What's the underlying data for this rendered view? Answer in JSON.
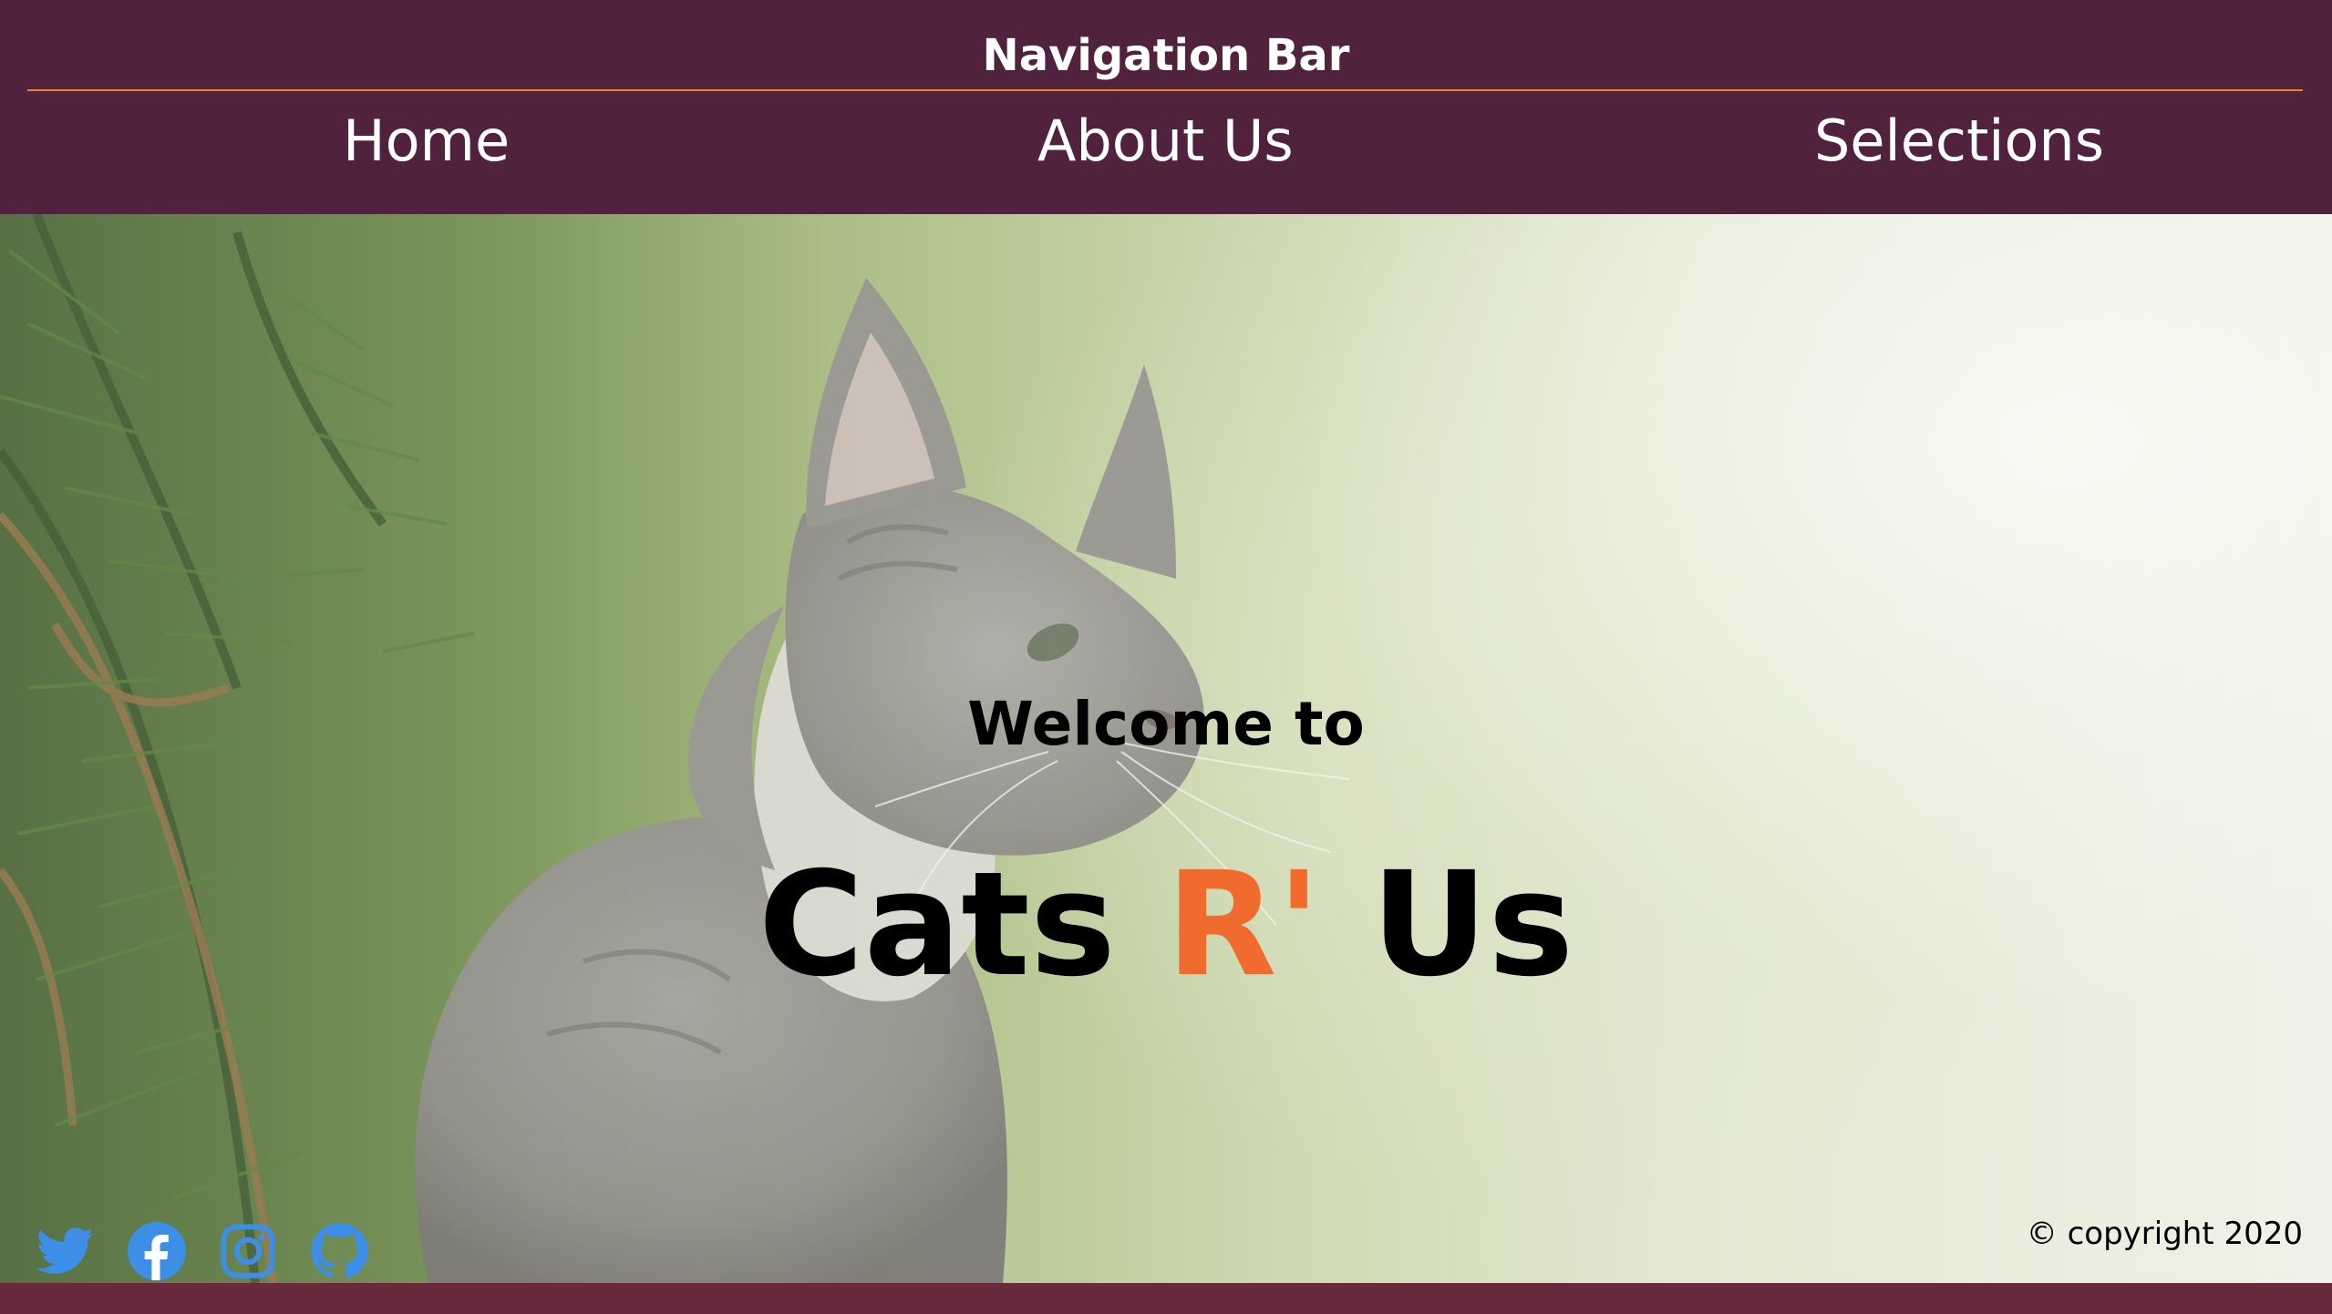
{
  "nav": {
    "title": "Navigation Bar",
    "links": [
      {
        "label": "Home"
      },
      {
        "label": "About Us"
      },
      {
        "label": "Selections"
      }
    ],
    "background": "#50223d",
    "rule_color": "#e8872a"
  },
  "hero": {
    "image": "cat-photo",
    "welcome": "Welcome to",
    "brand": {
      "part1": "Cats",
      "accent": "R'",
      "part2": "Us",
      "accent_color": "#f26b2e"
    }
  },
  "social": {
    "icons": [
      "twitter-icon",
      "facebook-icon",
      "instagram-icon",
      "github-icon"
    ],
    "color": "#3d8ee6"
  },
  "footer": {
    "copyright": "© copyright 2020",
    "strip_color": "#6a2a3d"
  }
}
